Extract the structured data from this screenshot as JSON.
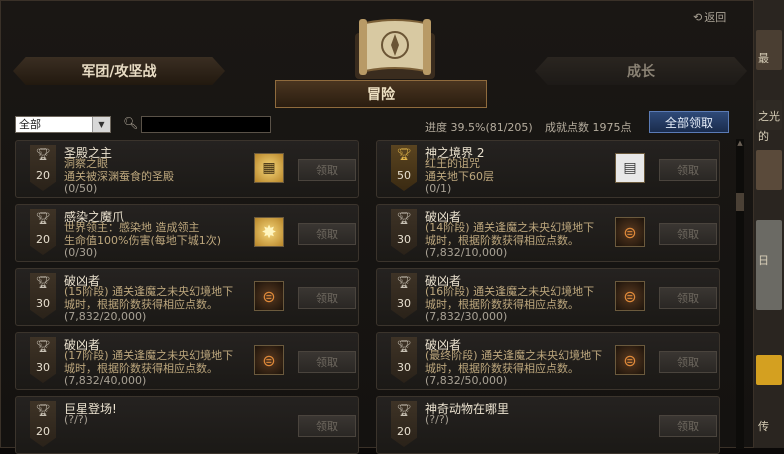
{
  "header": {
    "back_label": "返回",
    "tab_left": "军团/攻坚战",
    "tab_main": "冒险",
    "tab_right": "成长"
  },
  "filter": {
    "selected": "全部",
    "search_value": ""
  },
  "summary": {
    "progress": "进度 39.5%(81/205)",
    "points": "成就点数 1975点",
    "claim_all": "全部领取"
  },
  "claim_label": "领取",
  "cards": [
    {
      "title": "圣殿之主",
      "desc": "洞察之眼\n通关被深渊蚕食的圣殿",
      "progress": "(0/50)",
      "points": "20",
      "badge": "silver",
      "icon": "gold-panel-icon"
    },
    {
      "title": "神之境界 2",
      "desc": "红王的诅咒\n通关地下60层",
      "progress": "(0/1)",
      "points": "50",
      "badge": "gold",
      "icon": "scroll-paper-icon"
    },
    {
      "title": "感染之魔爪",
      "desc": "世界领主：感染地        造成领主\n生命值100%伤害(每地下城1次)",
      "progress": "(0/30)",
      "points": "20",
      "badge": "silver",
      "icon": "gold-burst-icon"
    },
    {
      "title": "破凶者",
      "desc": "(14阶段) 通关逢魔之未央幻境地下\n城时，根据阶数获得相应点数。",
      "progress": "(7,832/10,000)",
      "points": "30",
      "badge": "silver",
      "icon": "rune-emblem-icon"
    },
    {
      "title": "破凶者",
      "desc": "(15阶段) 通关逢魔之未央幻境地下\n城时，根据阶数获得相应点数。",
      "progress": "(7,832/20,000)",
      "points": "30",
      "badge": "silver",
      "icon": "rune-emblem-icon"
    },
    {
      "title": "破凶者",
      "desc": "(16阶段) 通关逢魔之未央幻境地下\n城时，根据阶数获得相应点数。",
      "progress": "(7,832/30,000)",
      "points": "30",
      "badge": "silver",
      "icon": "rune-emblem-icon"
    },
    {
      "title": "破凶者",
      "desc": "(17阶段) 通关逢魔之未央幻境地下\n城时，根据阶数获得相应点数。",
      "progress": "(7,832/40,000)",
      "points": "30",
      "badge": "silver",
      "icon": "rune-emblem-icon"
    },
    {
      "title": "破凶者",
      "desc": "(最终阶段) 通关逢魔之未央幻境地下\n城时，根据阶数获得相应点数。",
      "progress": "(7,832/50,000)",
      "points": "30",
      "badge": "silver",
      "icon": "rune-emblem-icon"
    },
    {
      "title": "巨星登场!",
      "desc": "",
      "progress": "(?/?)",
      "points": "20",
      "badge": "silver",
      "icon": ""
    },
    {
      "title": "神奇动物在哪里",
      "desc": "",
      "progress": "(?/?)",
      "points": "20",
      "badge": "silver",
      "icon": ""
    }
  ],
  "side_strip": [
    "最",
    "之光",
    "的",
    "日",
    "传"
  ]
}
